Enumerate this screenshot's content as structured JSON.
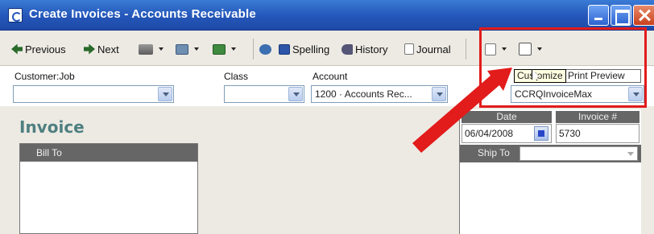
{
  "window": {
    "title": "Create Invoices - Accounts Receivable"
  },
  "toolbar": {
    "previous_label": "Previous",
    "next_label": "Next",
    "spelling_label": "Spelling",
    "history_label": "History",
    "journal_label": "Journal"
  },
  "fields": {
    "customer_job_label": "Customer:Job",
    "customer_job_value": "",
    "class_label": "Class",
    "class_value": "",
    "account_label": "Account",
    "account_value": "1200 · Accounts Rec...",
    "template_value": "CCRQInvoiceMax"
  },
  "template_tab": {
    "print_preview_label": "Print Preview"
  },
  "tooltip": {
    "text": "Customize"
  },
  "form": {
    "title": "Invoice",
    "bill_to_label": "Bill To",
    "ship_to_label": "Ship To",
    "date_label": "Date",
    "date_value": "06/04/2008",
    "invoice_no_label": "Invoice #",
    "invoice_no_value": "5730"
  },
  "colors": {
    "annotation": "#e21b1b",
    "invoice_title": "#4e7f80",
    "header_fill": "#666666"
  },
  "icons": [
    "app-icon",
    "previous-icon",
    "next-icon",
    "print-icon",
    "send-icon",
    "ship-icon",
    "find-icon",
    "spelling-icon",
    "history-icon",
    "journal-icon",
    "print-preview-icon",
    "customize-icon",
    "calendar-icon",
    "mouse-cursor-icon",
    "annotation-arrow-icon"
  ]
}
